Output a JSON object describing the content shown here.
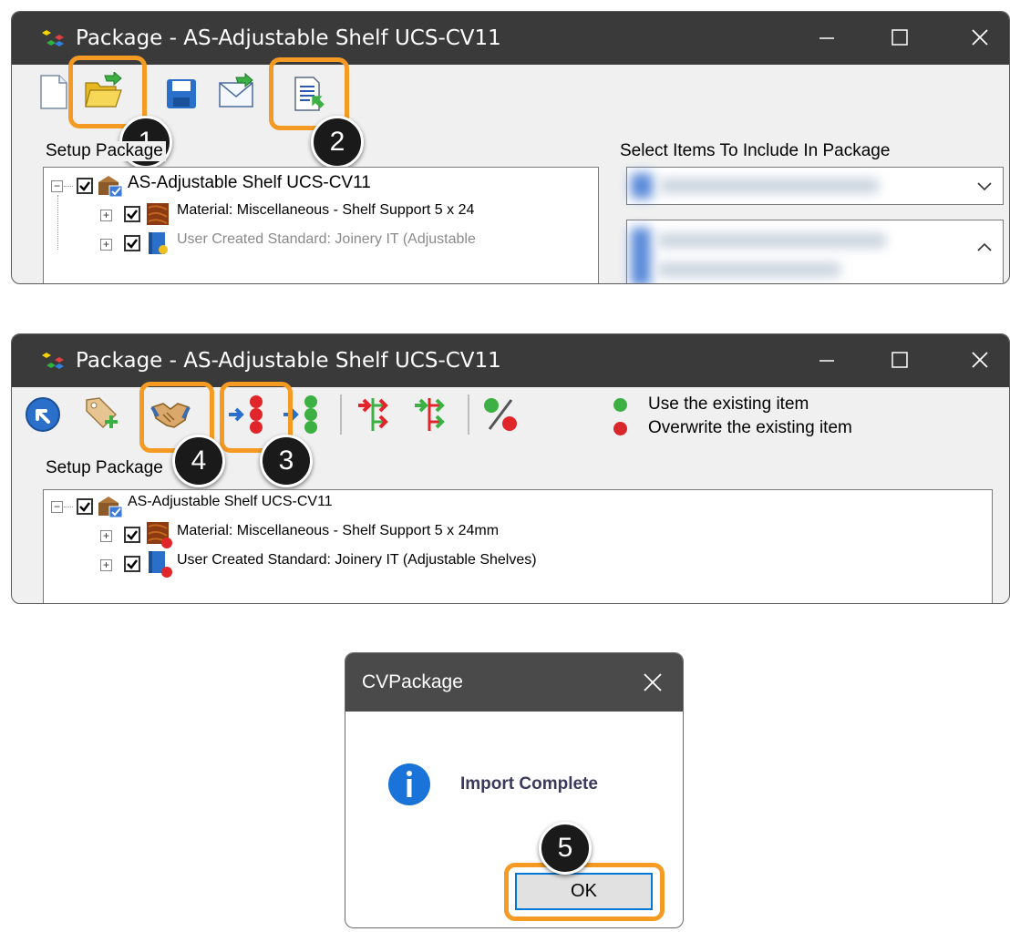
{
  "window1": {
    "title": "Package - AS-Adjustable Shelf UCS-CV11",
    "toolbar": {
      "icons": [
        "new-document-icon",
        "open-folder-icon",
        "save-icon",
        "email-icon",
        "export-icon"
      ]
    },
    "setup_label": "Setup Package",
    "select_label": "Select Items To Include In Package",
    "tree": {
      "root_label": "AS-Adjustable Shelf UCS-CV11",
      "items": [
        {
          "label": "Material: Miscellaneous - Shelf Support 5 x 24",
          "icon": "material-icon"
        },
        {
          "label": "User Created Standard: Joinery IT (Adjustable",
          "icon": "standard-book-icon"
        }
      ]
    }
  },
  "window2": {
    "title": "Package - AS-Adjustable Shelf UCS-CV11",
    "toolbar": {
      "icons": [
        "back-arrow-icon",
        "add-tag-icon",
        "handshake-icon",
        "overwrite-all-icon",
        "use-existing-all-icon",
        "red-branch-icon",
        "green-branch-icon",
        "percent-icon"
      ]
    },
    "legend": {
      "use_existing": "Use the existing item",
      "overwrite": "Overwrite the existing item"
    },
    "setup_label": "Setup Package",
    "tree": {
      "root_label": "AS-Adjustable Shelf UCS-CV11",
      "items": [
        {
          "label": "Material: Miscellaneous - Shelf Support 5 x 24mm",
          "icon": "material-icon"
        },
        {
          "label": "User Created Standard: Joinery IT (Adjustable Shelves)",
          "icon": "standard-book-icon"
        }
      ]
    }
  },
  "dialog": {
    "title": "CVPackage",
    "message": "Import Complete",
    "ok_label": "OK"
  },
  "steps": [
    "1",
    "2",
    "3",
    "4",
    "5"
  ],
  "colors": {
    "highlight": "#f59a23",
    "titlebar": "#3a3a3a",
    "legend_green": "#3cb043",
    "legend_red": "#d9262b",
    "info_blue": "#1a73d9"
  }
}
